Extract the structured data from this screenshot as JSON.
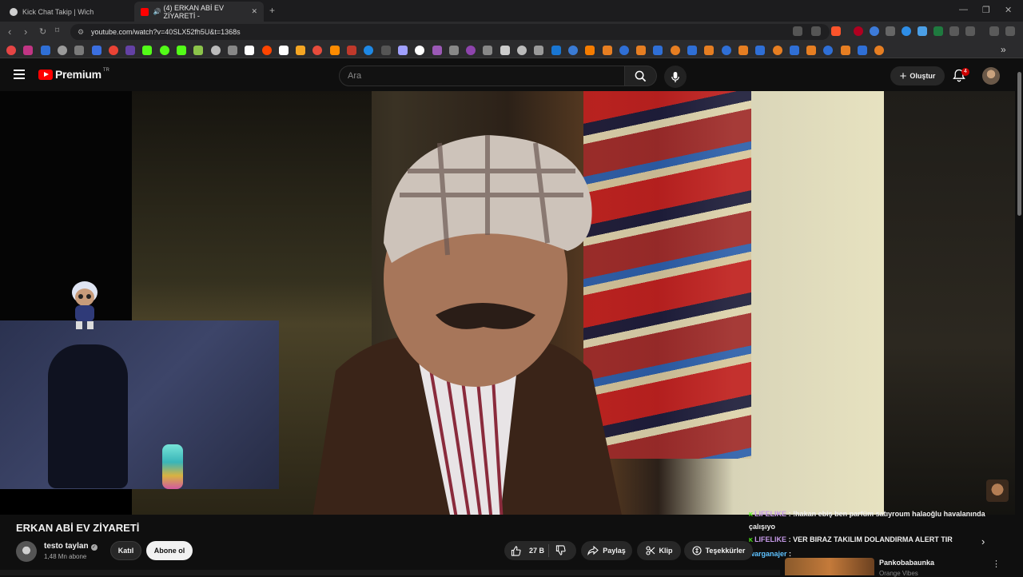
{
  "browser": {
    "tabs": [
      {
        "title": "Kick Chat Takip | Wich",
        "favicon_color": "#cfcfcf"
      },
      {
        "title": "(4) ERKAN ABİ EV ZİYARETİ -",
        "favicon_color": "#ff0000"
      }
    ],
    "new_tab": "+",
    "window_controls": {
      "minimize": "—",
      "restore": "❐",
      "close": "✕"
    },
    "url": "youtube.com/watch?v=40SLX52fh5U&t=1368s",
    "overflow_glyph": "»"
  },
  "youtube": {
    "logo_word": "Premium",
    "logo_region": "TR",
    "search_placeholder": "Ara",
    "create_label": "Oluştur",
    "create_plus": "+",
    "notification_count": "4"
  },
  "video": {
    "title": "ERKAN ABİ EV ZİYARETİ",
    "channel_name": "testo taylan",
    "verified_glyph": "✓",
    "subscriber_count": "1,48 Mn abone",
    "join_label": "Katıl",
    "subscribe_label": "Abone ol",
    "like_count": "27 B",
    "share_label": "Paylaş",
    "clip_label": "Klip",
    "thanks_label": "Teşekkürler"
  },
  "chat_overlay": [
    {
      "user": "LIFELIKE",
      "separator": " : ",
      "text": "!hakan ebiş ben parfüm satıyroum  halaoğlu havalanında çalışıyo"
    },
    {
      "user": "LIFELIKE",
      "separator": " : ",
      "text": "VER BIRAZ TAKILIM DOLANDIRMA ALERT TIR"
    },
    {
      "user": "warganajer",
      "separator": " : ",
      "text": ""
    }
  ],
  "chat_badge": "K",
  "recommended": {
    "next_glyph": "›",
    "title": "Pankobabaunka",
    "channel": "Orange Vibes",
    "more_glyph": "⋮"
  },
  "colors": {
    "youtube_red": "#ff0000",
    "kick_green": "#53fc18",
    "background": "#0f0f0f"
  }
}
